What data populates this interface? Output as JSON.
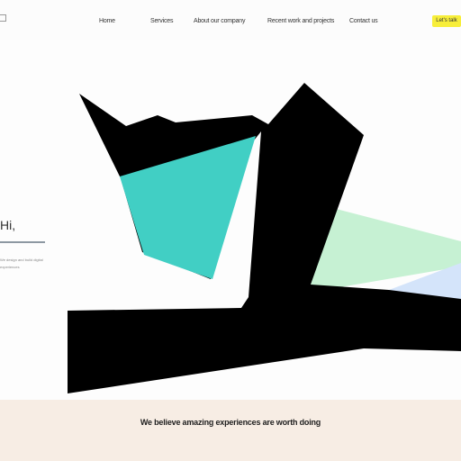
{
  "header": {
    "nav": [
      "Home",
      "Services",
      "About our company",
      "Recent work and projects",
      "Contact us"
    ],
    "cta_label": "Let's talk"
  },
  "hero": {
    "heading": "Hi,",
    "subtext": "We design and build digital experiences"
  },
  "footer": {
    "tagline": "We believe amazing experiences are worth doing"
  },
  "colors": {
    "cta_background": "#f7ee3a",
    "teal_shape": "#41cfc4",
    "green_shape": "#c6f1d3",
    "blue_shape": "#d4e4fa",
    "black_shape": "#000000",
    "footer_background": "#f7ede4"
  }
}
